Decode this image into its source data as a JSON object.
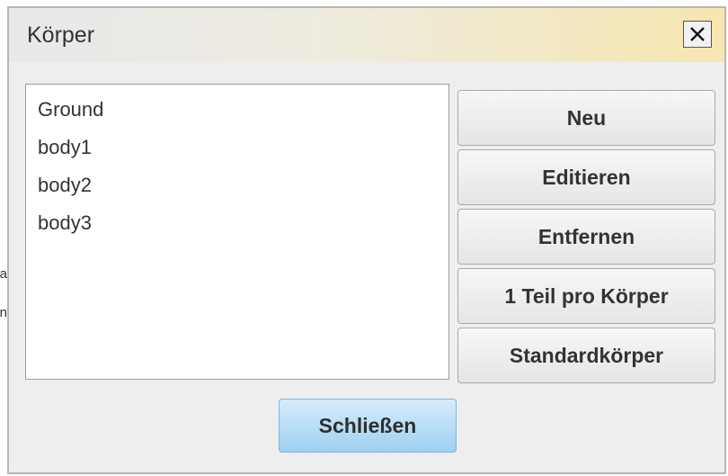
{
  "background": {
    "fragments": [
      "a",
      "n"
    ]
  },
  "dialog": {
    "title": "Körper",
    "close_icon": "close-icon",
    "list": {
      "items": [
        "Ground",
        "body1",
        "body2",
        "body3"
      ]
    },
    "buttons": {
      "new": "Neu",
      "edit": "Editieren",
      "remove": "Entfernen",
      "one_part_per_body": "1 Teil pro Körper",
      "standard_body": "Standardkörper"
    },
    "close_label": "Schließen"
  },
  "colors": {
    "title_bar_gradient_end": "#f6e6b0",
    "primary_button": "#9fd0f1",
    "dialog_background": "#eeeeee"
  }
}
